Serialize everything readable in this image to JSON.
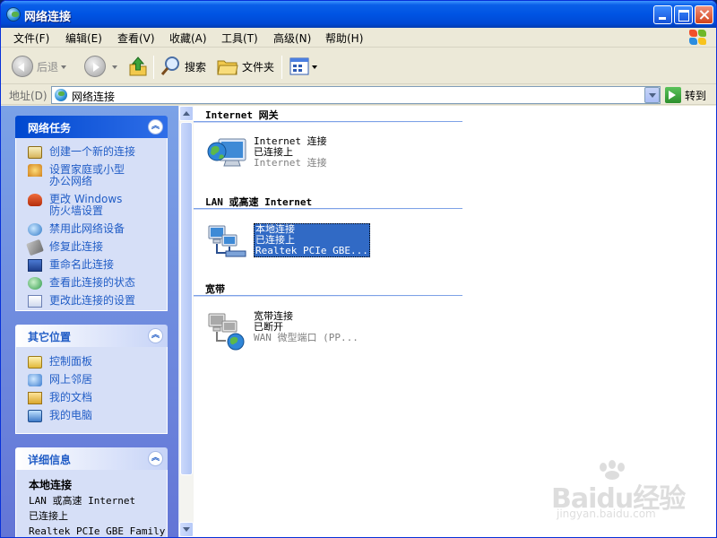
{
  "window": {
    "title": "网络连接"
  },
  "menu": [
    "文件(F)",
    "编辑(E)",
    "查看(V)",
    "收藏(A)",
    "工具(T)",
    "高级(N)",
    "帮助(H)"
  ],
  "toolbar": {
    "back": "后退",
    "search": "搜索",
    "folders": "文件夹"
  },
  "address": {
    "label": "地址(D)",
    "value": "网络连接",
    "go": "转到"
  },
  "tasks": {
    "network_tasks": {
      "title": "网络任务",
      "items": [
        "创建一个新的连接",
        "设置家庭或小型办公网络",
        "更改 Windows 防火墙设置",
        "禁用此网络设备",
        "修复此连接",
        "重命名此连接",
        "查看此连接的状态",
        "更改此连接的设置"
      ]
    },
    "other_places": {
      "title": "其它位置",
      "items": [
        "控制面板",
        "网上邻居",
        "我的文档",
        "我的电脑"
      ]
    },
    "details": {
      "title": "详细信息",
      "name": "本地连接",
      "type": "LAN 或高速 Internet",
      "status": "已连接上",
      "device": "Realtek PCIe GBE Family"
    }
  },
  "groups": [
    {
      "title": "Internet 网关",
      "item": {
        "name": "Internet 连接",
        "status": "已连接上",
        "device": "Internet 连接"
      }
    },
    {
      "title": "LAN 或高速 Internet",
      "item": {
        "name": "本地连接",
        "status": "已连接上",
        "device": "Realtek PCIe GBE..."
      }
    },
    {
      "title": "宽带",
      "item": {
        "name": "宽带连接",
        "status": "已断开",
        "device": "WAN 微型端口 (PP..."
      }
    }
  ],
  "watermark": {
    "text": "Baidu经验",
    "sub": "jingyan.baidu.com"
  },
  "colors": {
    "titlebar": "#0054e3",
    "taskpane": "#7ba2e7",
    "link": "#215dc6",
    "selection": "#316ac5"
  }
}
